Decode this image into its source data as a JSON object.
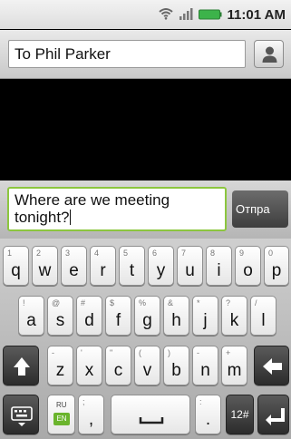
{
  "status_bar": {
    "time": "11:01 AM"
  },
  "recipient": {
    "value": "To Phil Parker"
  },
  "composer": {
    "message": "Where are we meeting tonight?",
    "send_label": "Отпра"
  },
  "keyboard": {
    "row1": [
      {
        "main": "q",
        "sub": "1"
      },
      {
        "main": "w",
        "sub": "2"
      },
      {
        "main": "e",
        "sub": "3"
      },
      {
        "main": "r",
        "sub": "4"
      },
      {
        "main": "t",
        "sub": "5"
      },
      {
        "main": "y",
        "sub": "6"
      },
      {
        "main": "u",
        "sub": "7"
      },
      {
        "main": "i",
        "sub": "8"
      },
      {
        "main": "o",
        "sub": "9"
      },
      {
        "main": "p",
        "sub": "0"
      }
    ],
    "row2": [
      {
        "main": "a",
        "sub": "!"
      },
      {
        "main": "s",
        "sub": "@"
      },
      {
        "main": "d",
        "sub": "#"
      },
      {
        "main": "f",
        "sub": "$"
      },
      {
        "main": "g",
        "sub": "%"
      },
      {
        "main": "h",
        "sub": "&"
      },
      {
        "main": "j",
        "sub": "*"
      },
      {
        "main": "k",
        "sub": "?"
      },
      {
        "main": "l",
        "sub": "/"
      }
    ],
    "row3": [
      {
        "main": "z",
        "sub": "-"
      },
      {
        "main": "x",
        "sub": "'"
      },
      {
        "main": "c",
        "sub": "\""
      },
      {
        "main": "v",
        "sub": "("
      },
      {
        "main": "b",
        "sub": ")"
      },
      {
        "main": "n",
        "sub": "-"
      },
      {
        "main": "m",
        "sub": "+"
      }
    ],
    "lang_top": "RU",
    "lang_bottom": "EN",
    "comma": ",",
    "comma_sub": ";",
    "period": ".",
    "period_sub": ":",
    "symbols_label": "12#"
  },
  "colors": {
    "accent": "#8cc63f",
    "lang_badge": "#6ab42c"
  }
}
